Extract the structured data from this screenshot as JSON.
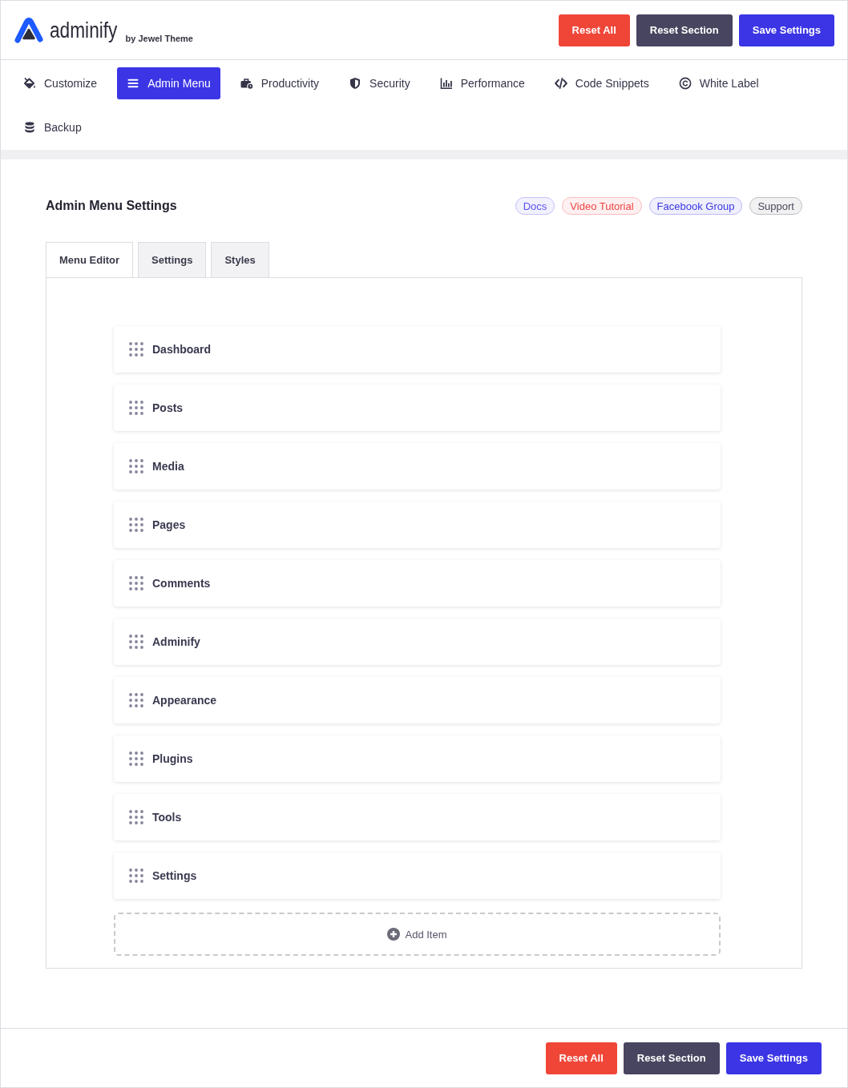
{
  "header": {
    "logo_text": "adminify",
    "byline": "by Jewel Theme",
    "buttons": [
      {
        "label": "Reset All",
        "kind": "danger"
      },
      {
        "label": "Reset Section",
        "kind": "secondary"
      },
      {
        "label": "Save Settings",
        "kind": "primary"
      }
    ]
  },
  "nav": [
    {
      "label": "Customize",
      "selected": false
    },
    {
      "label": "Admin Menu",
      "selected": true
    },
    {
      "label": "Productivity",
      "selected": false
    },
    {
      "label": "Security",
      "selected": false
    },
    {
      "label": "Performance",
      "selected": false
    },
    {
      "label": "Code Snippets",
      "selected": false
    },
    {
      "label": "White Label",
      "selected": false
    },
    {
      "label": "Backup",
      "selected": false
    }
  ],
  "section": {
    "title": "Admin Menu Settings",
    "links": [
      {
        "label": "Docs",
        "color": "#5a52f2"
      },
      {
        "label": "Video Tutorial",
        "color": "#ef4444"
      },
      {
        "label": "Facebook Group",
        "color": "#3b37e0"
      },
      {
        "label": "Support",
        "color": "#4a4a5c"
      }
    ]
  },
  "tabs": [
    {
      "label": "Menu Editor",
      "selected": true
    },
    {
      "label": "Settings",
      "selected": false
    },
    {
      "label": "Styles",
      "selected": false
    }
  ],
  "menu_items": [
    "Dashboard",
    "Posts",
    "Media",
    "Pages",
    "Comments",
    "Adminify",
    "Appearance",
    "Plugins",
    "Tools",
    "Settings"
  ],
  "add_item": {
    "label": "Add Item"
  },
  "footer": {
    "buttons": [
      {
        "label": "Reset All",
        "kind": "danger"
      },
      {
        "label": "Reset Section",
        "kind": "secondary"
      },
      {
        "label": "Save Settings",
        "kind": "primary"
      }
    ]
  }
}
